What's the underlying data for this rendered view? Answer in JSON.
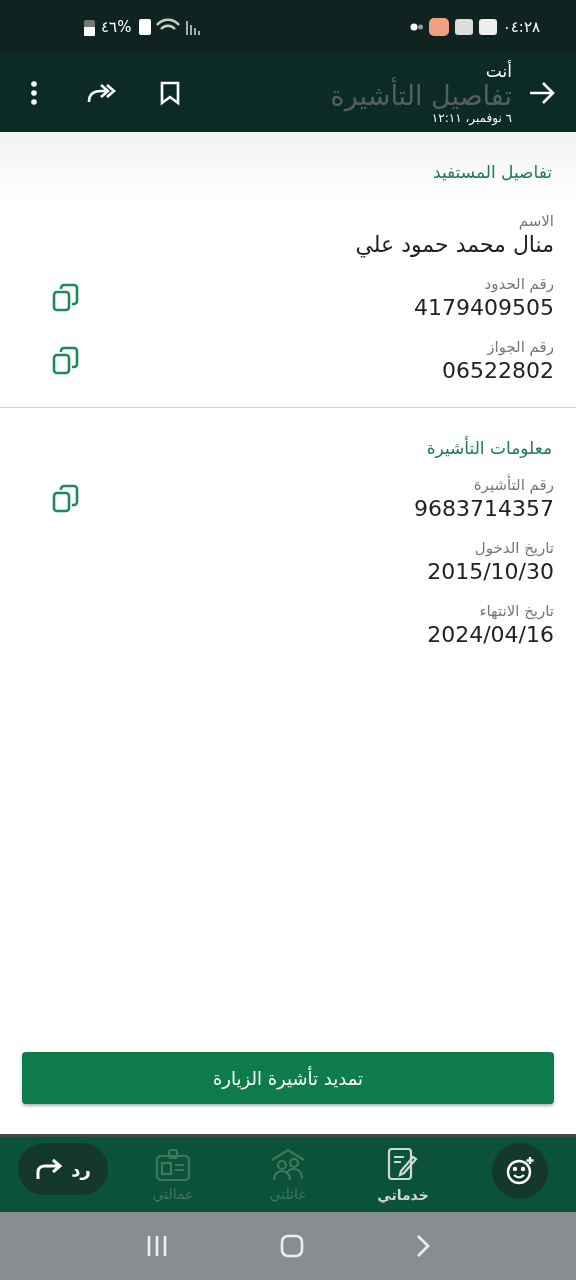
{
  "status_bar": {
    "time": "٠٤:٢٨",
    "battery": "%٤٦"
  },
  "header": {
    "sender": "أنت",
    "date": "٦ نوفمبر، ١٢:١١",
    "page_title": "تفاصيل التأشيرة"
  },
  "sections": [
    {
      "title": "تفاصيل المستفيد",
      "fields": [
        {
          "label": "الاسم",
          "value": "منال محمد حمود علي",
          "copyable": false
        },
        {
          "label": "رقم الحدود",
          "value": "4179409505",
          "copyable": true
        },
        {
          "label": "رقم الجواز",
          "value": "06522802",
          "copyable": true
        }
      ]
    },
    {
      "title": "معلومات التأشيرة",
      "fields": [
        {
          "label": "رقم التأشيرة",
          "value": "9683714357",
          "copyable": true
        },
        {
          "label": "تاريخ الدخول",
          "value": "2015/10/30",
          "copyable": false
        },
        {
          "label": "تاريخ الانتهاء",
          "value": "2024/04/16",
          "copyable": false
        }
      ]
    }
  ],
  "action_button": "تمديد تأشيرة الزيارة",
  "bottom_nav": [
    {
      "kind": "services",
      "label": "خدماتي",
      "selected": true
    },
    {
      "kind": "family",
      "label": "عائلتي",
      "selected": false
    },
    {
      "kind": "workers",
      "label": "عمالتي",
      "selected": false
    }
  ],
  "reply_button": "رد"
}
